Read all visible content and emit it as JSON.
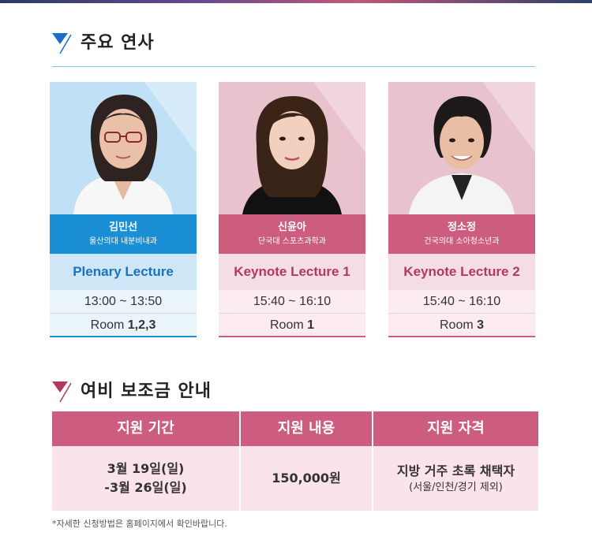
{
  "speakers_section": {
    "title": "주요 연사"
  },
  "speakers": [
    {
      "name": "김민선",
      "affiliation": "울산의대 내분비내과",
      "lecture": "Plenary Lecture",
      "time": "13:00 ~ 13:50",
      "room_prefix": "Room ",
      "room_number": "1,2,3",
      "theme_color": "#1b8fd6"
    },
    {
      "name": "신윤아",
      "affiliation": "단국대 스포츠과학과",
      "lecture": "Keynote Lecture 1",
      "time": "15:40 ~ 16:10",
      "room_prefix": "Room ",
      "room_number": "1",
      "theme_color": "#cc5d7e"
    },
    {
      "name": "정소정",
      "affiliation": "건국의대 소아청소년과",
      "lecture": "Keynote Lecture 2",
      "time": "15:40 ~ 16:10",
      "room_prefix": "Room ",
      "room_number": "3",
      "theme_color": "#cc5d7e"
    }
  ],
  "grant_section": {
    "title": "여비 보조금 안내"
  },
  "grant_table": {
    "period": {
      "header": "지원 기간",
      "line1": "3월 19일(일)",
      "line2": "-3월 26일(일)"
    },
    "content": {
      "header": "지원 내용",
      "value": "150,000원"
    },
    "eligibility": {
      "header": "지원 자격",
      "line1": "지방 거주 초록 채택자",
      "line2": "(서울/인천/경기 제외)"
    }
  },
  "footnote": "*자세한 신청방법은 홈페이지에서 확인바랍니다."
}
